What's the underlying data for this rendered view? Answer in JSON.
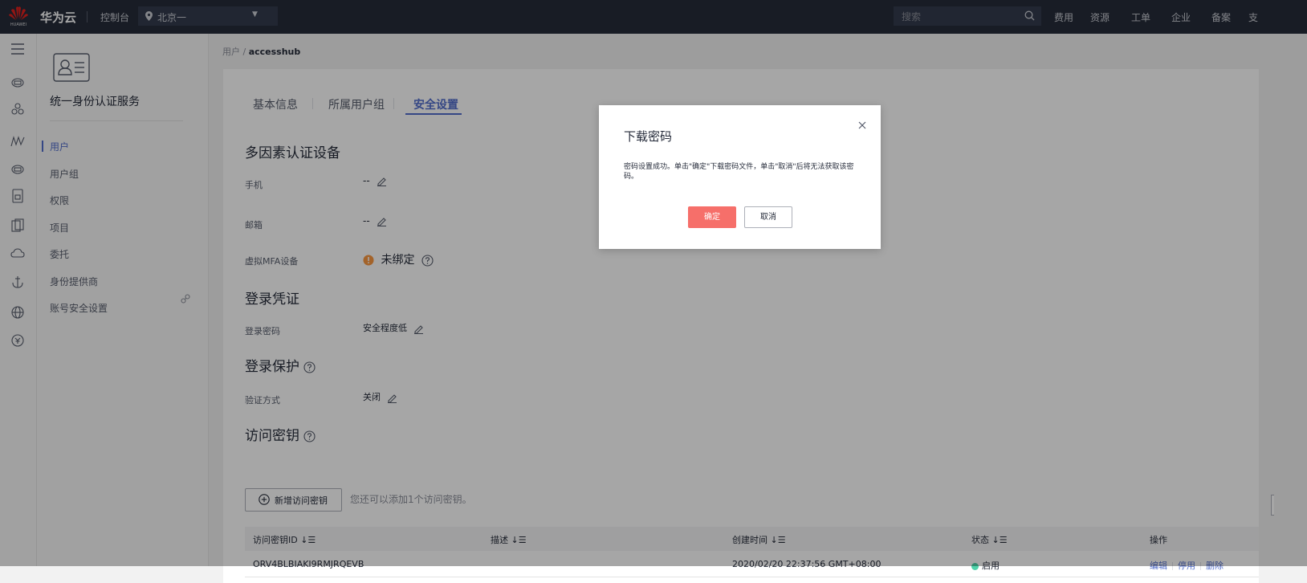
{
  "topbar": {
    "logo_text": "HUAWEI",
    "brand": "华为云",
    "console": "控制台",
    "region": "北京一",
    "search_placeholder": "搜索",
    "nav": [
      "费用",
      "资源",
      "工单",
      "企业",
      "备案",
      "支"
    ]
  },
  "sidebar": {
    "service_title": "统一身份认证服务",
    "items": [
      {
        "label": "用户",
        "active": true
      },
      {
        "label": "用户组",
        "active": false
      },
      {
        "label": "权限",
        "active": false
      },
      {
        "label": "项目",
        "active": false
      },
      {
        "label": "委托",
        "active": false
      },
      {
        "label": "身份提供商",
        "active": false
      },
      {
        "label": "账号安全设置",
        "active": false
      }
    ]
  },
  "breadcrumb": {
    "parent": "用户",
    "separator": " / ",
    "current": "accesshub"
  },
  "tabs": [
    {
      "label": "基本信息",
      "active": false
    },
    {
      "label": "所属用户组",
      "active": false
    },
    {
      "label": "安全设置",
      "active": true
    }
  ],
  "mfa": {
    "title": "多因素认证设备",
    "phone_label": "手机",
    "phone_value": "--",
    "email_label": "邮箱",
    "email_value": "--",
    "vmfa_label": "虚拟MFA设备",
    "vmfa_value": "未绑定"
  },
  "login_cred": {
    "title": "登录凭证",
    "password_label": "登录密码",
    "password_value": "安全程度低"
  },
  "login_protect": {
    "title": "登录保护",
    "method_label": "验证方式",
    "method_value": "关闭"
  },
  "access_keys": {
    "title": "访问密钥",
    "add_button": "新增访问密钥",
    "hint": "您还可以添加1个访问密钥。",
    "columns": [
      "访问密钥ID",
      "描述",
      "创建时间",
      "状态",
      "操作"
    ],
    "rows": [
      {
        "id": "ORV4BLBIAKI9RMJRQEVB",
        "description": "",
        "created": "2020/02/20 22:37:56 GMT+08:00",
        "status": "启用",
        "actions": [
          "编辑",
          "停用",
          "删除"
        ]
      }
    ]
  },
  "dialog": {
    "title": "下载密码",
    "message": "密码设置成功。单击\"确定\"下载密码文件，单击\"取消\"后将无法获取该密码。",
    "ok": "确定",
    "cancel": "取消"
  },
  "colors": {
    "topbar": "#252b3a",
    "accent": "#526ecc",
    "danger_button": "#f66f6a",
    "warning": "#fa9841",
    "status_ok": "#50d4ab"
  }
}
